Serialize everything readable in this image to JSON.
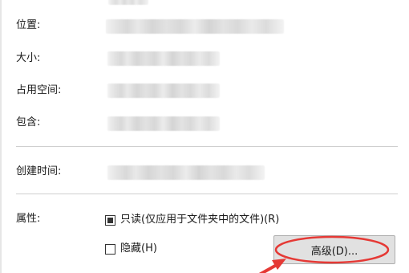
{
  "labels": {
    "location": "位置:",
    "size": "大小:",
    "size_on_disk": "占用空间:",
    "contains": "包含:",
    "created": "创建时间:",
    "attributes": "属性:"
  },
  "attributes": {
    "readonly": {
      "label": "只读(仅应用于文件夹中的文件)(R)",
      "state": "indeterminate"
    },
    "hidden": {
      "label": "隐藏(H)",
      "checked": false
    },
    "advanced_button": "高级(D)..."
  },
  "colors": {
    "annotation_red": "#e53935",
    "button_bg": "#e1e1e1",
    "divider": "#cfcfcf"
  }
}
